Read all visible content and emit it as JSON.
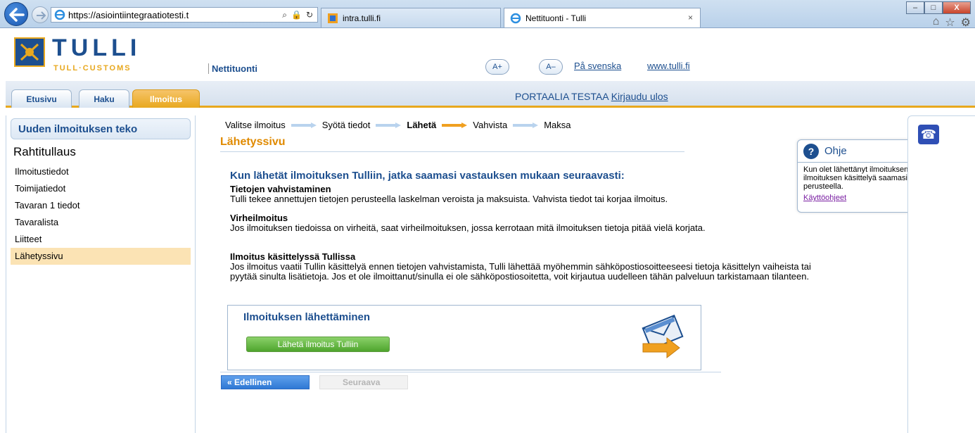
{
  "browser": {
    "url": "https://asiointiintegraatiotesti.t",
    "tabs": [
      {
        "label": "intra.tulli.fi"
      },
      {
        "label": "Nettituonti - Tulli",
        "close": "×"
      }
    ],
    "window_buttons": [
      "–",
      "□",
      "X"
    ]
  },
  "header": {
    "logo_title": "TULLI",
    "logo_sub": "TULL·CUSTOMS",
    "service": "Nettituonti",
    "font_up": "A+",
    "font_down": "A–",
    "lang_link": "På svenska",
    "site_link": "www.tulli.fi",
    "brand_color": "#1d4f8f",
    "accent_color": "#e8a81e"
  },
  "nav": {
    "tabs": [
      {
        "label": "Etusivu"
      },
      {
        "label": "Haku"
      },
      {
        "label": "Ilmoitus",
        "active": true
      }
    ],
    "user": "PORTAALIA TESTAA",
    "logout": "Kirjaudu ulos"
  },
  "sidebar": {
    "heading": "Uuden ilmoituksen teko",
    "title": "Rahtitullaus",
    "items": [
      {
        "label": "Ilmoitustiedot"
      },
      {
        "label": "Toimijatiedot"
      },
      {
        "label": "Tavaran 1 tiedot"
      },
      {
        "label": "Tavaralista"
      },
      {
        "label": "Liitteet"
      },
      {
        "label": "Lähetyssivu",
        "active": true
      }
    ]
  },
  "steps": [
    {
      "label": "Valitse ilmoitus"
    },
    {
      "label": "Syötä tiedot"
    },
    {
      "label": "Lähetä",
      "current": true
    },
    {
      "label": "Vahvista"
    },
    {
      "label": "Maksa"
    }
  ],
  "main": {
    "title": "Lähetyssivu",
    "intro": "Kun lähetät ilmoituksen Tulliin, jatka saamasi vastauksen mukaan seuraavasti:",
    "sections": [
      {
        "heading": "Tietojen vahvistaminen",
        "text": "Tulli tekee annettujen tietojen perusteella laskelman veroista ja maksuista. Vahvista tiedot tai korjaa ilmoitus."
      },
      {
        "heading": "Virheilmoitus",
        "text": "Jos ilmoituksen tiedoissa on virheitä, saat virheilmoituksen, jossa kerrotaan mitä ilmoituksen tietoja pitää vielä korjata."
      },
      {
        "heading": "Ilmoitus käsittelyssä Tullissa",
        "text": "Jos ilmoitus vaatii Tullin käsittelyä ennen tietojen vahvistamista, Tulli lähettää myöhemmin sähköpostiosoitteeseesi tietoja käsittelyn vaiheista tai pyytää sinulta lisätietoja. Jos et ole ilmoittanut/sinulla ei ole sähköpostiosoitetta, voit kirjautua uudelleen tähän palveluun tarkistamaan tilanteen."
      }
    ],
    "send_box": {
      "title": "Ilmoituksen lähettäminen",
      "button": "Lähetä ilmoitus Tulliin"
    },
    "prev_button": "« Edellinen",
    "next_button": "Seuraava"
  },
  "help": {
    "title": "Ohje",
    "text": "Kun olet lähettänyt ilmoituksen Tulliin, jatka ilmoituksen käsittelyä saamasi vastauksen perusteella.",
    "link": "Käyttöohjeet"
  }
}
